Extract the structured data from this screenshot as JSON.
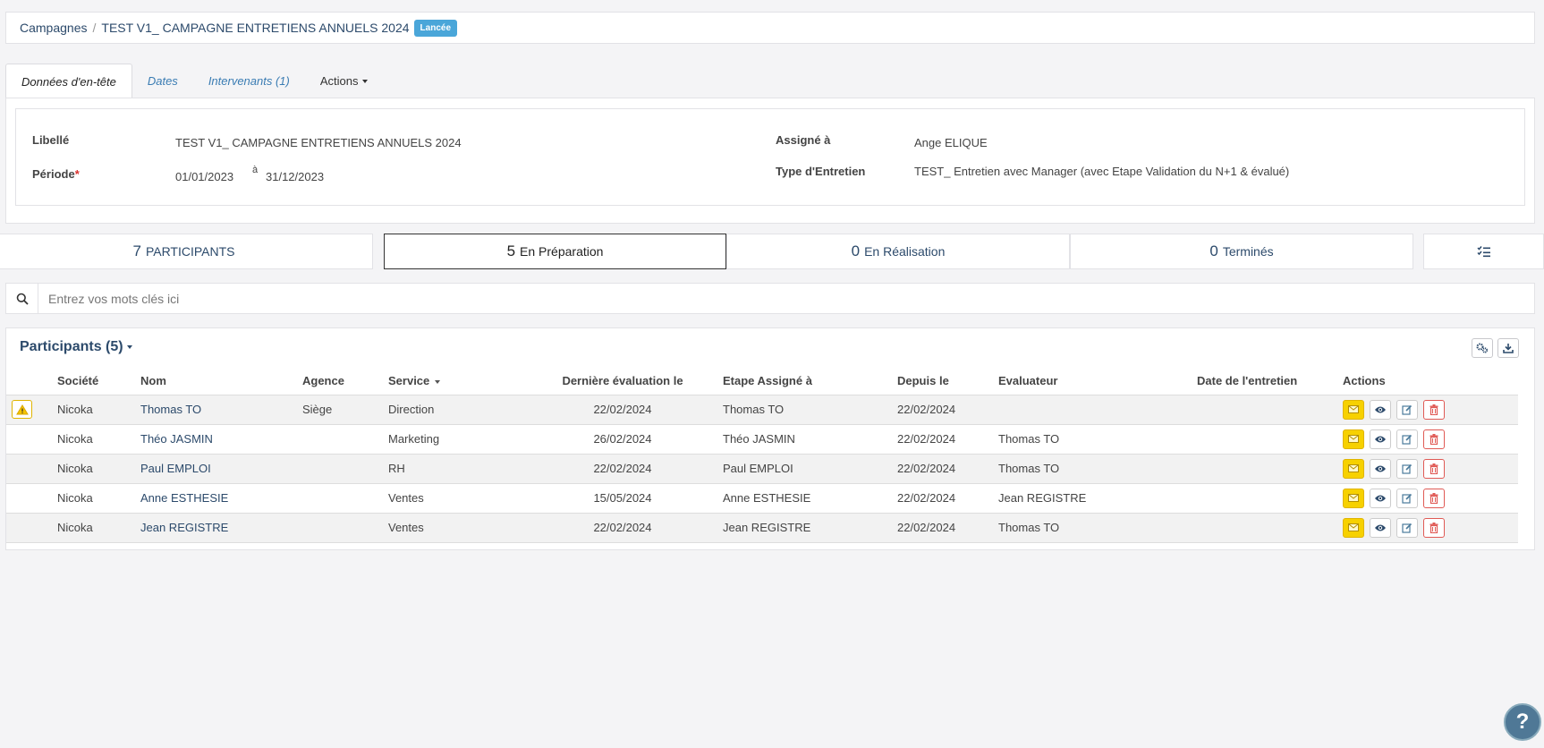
{
  "breadcrumb": {
    "root": "Campagnes",
    "separator": "/",
    "current": "TEST V1_ CAMPAGNE ENTRETIENS ANNUELS 2024",
    "status_badge": "Lancée"
  },
  "tabs": [
    {
      "label": "Données d'en-tête",
      "active": true
    },
    {
      "label": "Dates",
      "active": false
    },
    {
      "label": "Intervenants (1)",
      "active": false
    },
    {
      "label": "Actions",
      "active": false
    }
  ],
  "header": {
    "libelle_label": "Libellé",
    "libelle_value": "TEST V1_ CAMPAGNE ENTRETIENS ANNUELS 2024",
    "periode_label": "Période",
    "periode_required": "*",
    "periode_start": "01/01/2023",
    "periode_sep": "à",
    "periode_end": "31/12/2023",
    "assigne_label": "Assigné à",
    "assigne_value": "Ange ELIQUE",
    "type_label": "Type d'Entretien",
    "type_value": "TEST_ Entretien avec Manager (avec Etape Validation du N+1 & évalué)"
  },
  "stats": [
    {
      "count": "7",
      "label": "PARTICIPANTS"
    },
    {
      "count": "5",
      "label": "En Préparation"
    },
    {
      "count": "0",
      "label": "En Réalisation"
    },
    {
      "count": "0",
      "label": "Terminés"
    }
  ],
  "search": {
    "placeholder": "Entrez vos mots clés ici",
    "icon": "search-icon"
  },
  "participants": {
    "title": "Participants (5)",
    "columns": [
      "Société",
      "Nom",
      "Agence",
      "Service",
      "Dernière évaluation le",
      "Etape Assigné à",
      "Depuis le",
      "Evaluateur",
      "Date de l'entretien",
      "Actions"
    ],
    "rows": [
      {
        "warning": true,
        "societe": "Nicoka",
        "nom": "Thomas TO",
        "agence": "Siège",
        "service": "Direction",
        "derniere": "22/02/2024",
        "etape": "Thomas TO",
        "depuis": "22/02/2024",
        "evaluateur": "",
        "date_entretien": ""
      },
      {
        "warning": false,
        "societe": "Nicoka",
        "nom": "Théo JASMIN",
        "agence": "",
        "service": "Marketing",
        "derniere": "26/02/2024",
        "etape": "Théo JASMIN",
        "depuis": "22/02/2024",
        "evaluateur": "Thomas TO",
        "date_entretien": ""
      },
      {
        "warning": false,
        "societe": "Nicoka",
        "nom": "Paul EMPLOI",
        "agence": "",
        "service": "RH",
        "derniere": "22/02/2024",
        "etape": "Paul EMPLOI",
        "depuis": "22/02/2024",
        "evaluateur": "Thomas TO",
        "date_entretien": ""
      },
      {
        "warning": false,
        "societe": "Nicoka",
        "nom": "Anne ESTHESIE",
        "agence": "",
        "service": "Ventes",
        "derniere": "15/05/2024",
        "etape": "Anne ESTHESIE",
        "depuis": "22/02/2024",
        "evaluateur": "Jean REGISTRE",
        "date_entretien": ""
      },
      {
        "warning": false,
        "societe": "Nicoka",
        "nom": "Jean REGISTRE",
        "agence": "",
        "service": "Ventes",
        "derniere": "22/02/2024",
        "etape": "Jean REGISTRE",
        "depuis": "22/02/2024",
        "evaluateur": "Thomas TO",
        "date_entretien": ""
      }
    ]
  },
  "help": {
    "label": "?"
  },
  "colors": {
    "accent": "#2c4a6b",
    "badge": "#4aa6d9",
    "mail": "#f7d100",
    "delete": "#e05a55"
  }
}
